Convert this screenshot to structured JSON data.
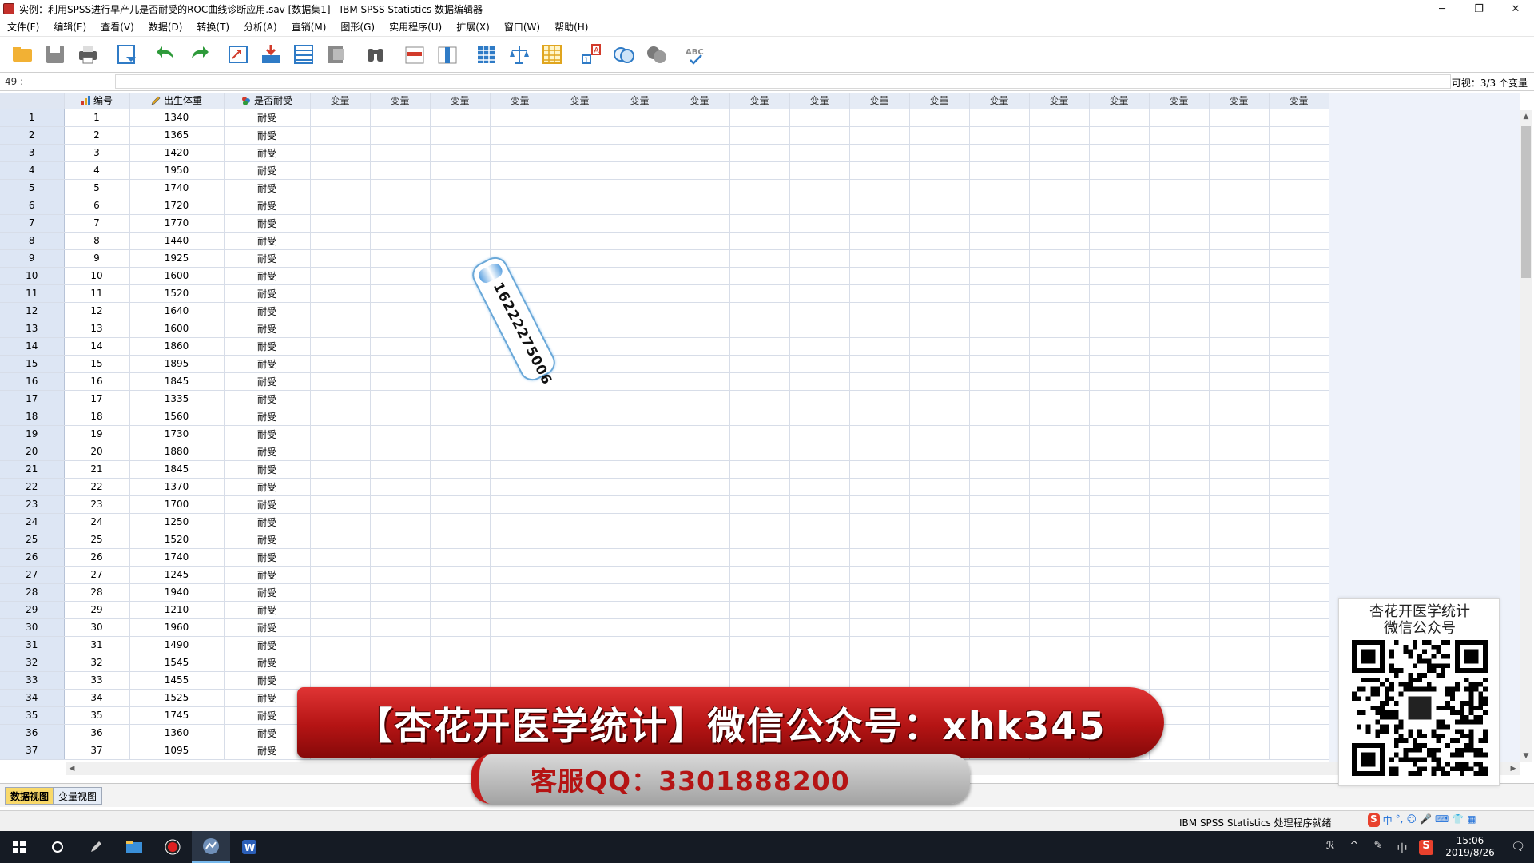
{
  "window": {
    "title": "实例：利用SPSS进行早产儿是否耐受的ROC曲线诊断应用.sav [数据集1] - IBM SPSS Statistics 数据编辑器",
    "minimize": "─",
    "maximize": "❐",
    "close": "✕"
  },
  "menu": [
    "文件(F)",
    "编辑(E)",
    "查看(V)",
    "数据(D)",
    "转换(T)",
    "分析(A)",
    "直销(M)",
    "图形(G)",
    "实用程序(U)",
    "扩展(X)",
    "窗口(W)",
    "帮助(H)"
  ],
  "toolbar": [
    {
      "name": "open-icon",
      "color": "#f2b134"
    },
    {
      "name": "save-icon",
      "color": "#8a8a8a"
    },
    {
      "name": "print-icon",
      "color": "#5b5b5b"
    },
    {
      "name": "recall-dialog-icon",
      "color": "#2f7bc6"
    },
    {
      "name": "undo-icon",
      "color": "#2e9a3a"
    },
    {
      "name": "redo-icon",
      "color": "#2e9a3a"
    },
    {
      "name": "goto-case-icon",
      "color": "#2f7bc6"
    },
    {
      "name": "goto-variable-icon",
      "color": "#d23b2b"
    },
    {
      "name": "variables-icon",
      "color": "#2f7bc6"
    },
    {
      "name": "run-descriptives-icon",
      "color": "#8a8a8a"
    },
    {
      "name": "find-icon",
      "color": "#555555"
    },
    {
      "name": "insert-cases-icon",
      "color": "#d23b2b"
    },
    {
      "name": "insert-variable-icon",
      "color": "#2f7bc6"
    },
    {
      "name": "split-file-icon",
      "color": "#2f7bc6"
    },
    {
      "name": "weight-cases-icon",
      "color": "#2f7bc6"
    },
    {
      "name": "select-cases-icon",
      "color": "#e0a51e"
    },
    {
      "name": "value-labels-icon",
      "color": "#d23b2b"
    },
    {
      "name": "use-sets-icon",
      "color": "#2f7bc6"
    },
    {
      "name": "show-all-variables-icon",
      "color": "#7a7a7a"
    },
    {
      "name": "spell-check-icon",
      "color": "#8a8a8a"
    }
  ],
  "cellbar": {
    "ref": "49 :",
    "visible": "可视：3/3 个变量"
  },
  "columns": [
    {
      "label": "编号",
      "icon": "scale-icon"
    },
    {
      "label": "出生体重",
      "icon": "pencil-scale-icon"
    },
    {
      "label": "是否耐受",
      "icon": "nominal-icon"
    }
  ],
  "empty_column_label": "变量",
  "empty_column_count": 17,
  "rows": [
    [
      "1",
      "1",
      "1340",
      "耐受"
    ],
    [
      "2",
      "2",
      "1365",
      "耐受"
    ],
    [
      "3",
      "3",
      "1420",
      "耐受"
    ],
    [
      "4",
      "4",
      "1950",
      "耐受"
    ],
    [
      "5",
      "5",
      "1740",
      "耐受"
    ],
    [
      "6",
      "6",
      "1720",
      "耐受"
    ],
    [
      "7",
      "7",
      "1770",
      "耐受"
    ],
    [
      "8",
      "8",
      "1440",
      "耐受"
    ],
    [
      "9",
      "9",
      "1925",
      "耐受"
    ],
    [
      "10",
      "10",
      "1600",
      "耐受"
    ],
    [
      "11",
      "11",
      "1520",
      "耐受"
    ],
    [
      "12",
      "12",
      "1640",
      "耐受"
    ],
    [
      "13",
      "13",
      "1600",
      "耐受"
    ],
    [
      "14",
      "14",
      "1860",
      "耐受"
    ],
    [
      "15",
      "15",
      "1895",
      "耐受"
    ],
    [
      "16",
      "16",
      "1845",
      "耐受"
    ],
    [
      "17",
      "17",
      "1335",
      "耐受"
    ],
    [
      "18",
      "18",
      "1560",
      "耐受"
    ],
    [
      "19",
      "19",
      "1730",
      "耐受"
    ],
    [
      "20",
      "20",
      "1880",
      "耐受"
    ],
    [
      "21",
      "21",
      "1845",
      "耐受"
    ],
    [
      "22",
      "22",
      "1370",
      "耐受"
    ],
    [
      "23",
      "23",
      "1700",
      "耐受"
    ],
    [
      "24",
      "24",
      "1250",
      "耐受"
    ],
    [
      "25",
      "25",
      "1520",
      "耐受"
    ],
    [
      "26",
      "26",
      "1740",
      "耐受"
    ],
    [
      "27",
      "27",
      "1245",
      "耐受"
    ],
    [
      "28",
      "28",
      "1940",
      "耐受"
    ],
    [
      "29",
      "29",
      "1210",
      "耐受"
    ],
    [
      "30",
      "30",
      "1960",
      "耐受"
    ],
    [
      "31",
      "31",
      "1490",
      "耐受"
    ],
    [
      "32",
      "32",
      "1545",
      "耐受"
    ],
    [
      "33",
      "33",
      "1455",
      "耐受"
    ],
    [
      "34",
      "34",
      "1525",
      "耐受"
    ],
    [
      "35",
      "35",
      "1745",
      "耐受"
    ],
    [
      "36",
      "36",
      "1360",
      "耐受"
    ],
    [
      "37",
      "37",
      "1095",
      "耐受"
    ]
  ],
  "tabs": {
    "data_view": "数据视图",
    "variable_view": "变量视图"
  },
  "status": "IBM SPSS Statistics 处理程序就绪",
  "ime": [
    "S",
    "中",
    "°,",
    "☺",
    "🎤",
    "⌨",
    "👕",
    "▦"
  ],
  "taskbar": {
    "apps": [
      "windows-start-icon",
      "cortana-search-icon",
      "pen-tool-icon",
      "file-explorer-icon",
      "screen-recorder-icon",
      "spss-icon",
      "word-icon"
    ],
    "tray": [
      "ℛ",
      "^",
      "✎",
      "中",
      "S"
    ],
    "time": "15:06",
    "date": "2019/8/26"
  },
  "overlay": {
    "sticker_number": "16222275006",
    "banner": "【杏花开医学统计】微信公众号：xhk345",
    "qq": "客服QQ：3301888200",
    "qr_title_line1": "杏花开医学统计",
    "qr_title_line2": "微信公众号"
  }
}
